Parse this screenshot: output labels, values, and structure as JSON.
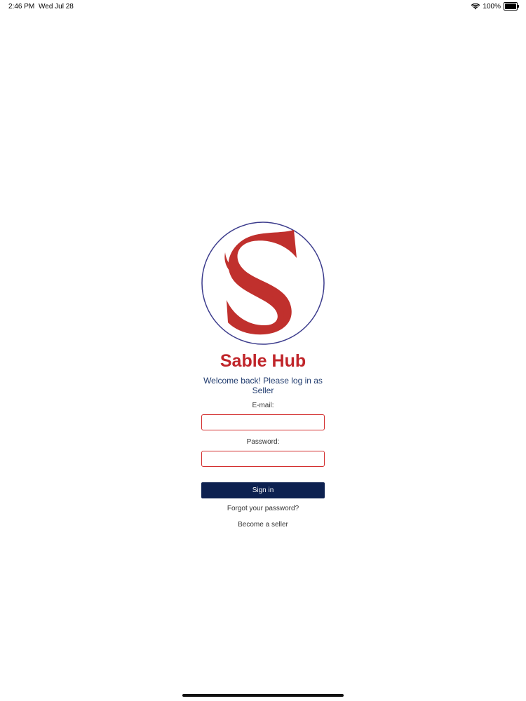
{
  "status_bar": {
    "time": "2:46 PM",
    "date": "Wed Jul 28",
    "battery": "100%",
    "icons": [
      "wifi-icon",
      "battery-icon"
    ]
  },
  "brand": {
    "name": "Sable Hub",
    "logo": "sable-hub-s-logo",
    "primary_color": "#c0252a",
    "ring_color": "#3b3b8c"
  },
  "login": {
    "welcome": "Welcome back! Please log in as Seller",
    "email_label": "E-mail:",
    "email_value": "",
    "password_label": "Password:",
    "password_value": "",
    "signin_label": "Sign in",
    "forgot_label": "Forgot your password?",
    "become_seller_label": "Become a seller",
    "button_color": "#0d2150"
  }
}
